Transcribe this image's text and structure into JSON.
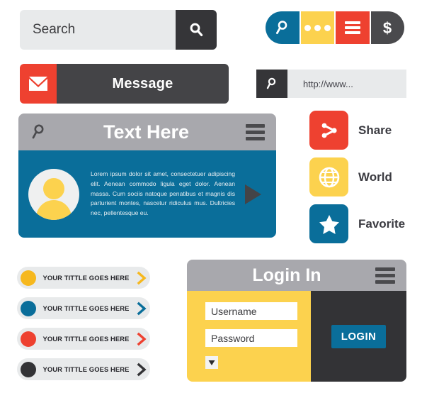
{
  "palette": {
    "blue": "#0a6e9a",
    "yellow": "#fcd24e",
    "amber": "#f6b81e",
    "red": "#ee4130",
    "dark": "#353538",
    "dark_alt": "#444447",
    "gray_header": "#a8a8ad",
    "light_gray": "#e8eaeb",
    "white": "#ffffff"
  },
  "search_bar": {
    "value": "Search",
    "placeholder": "Search",
    "button_icon": "search-icon"
  },
  "message_bar": {
    "label": "Message",
    "icon": "envelope-icon"
  },
  "pill_nav": {
    "segments": [
      {
        "icon": "search-icon",
        "color": "#0a6e9a"
      },
      {
        "icon": "dots-icon",
        "color": "#fcd24e"
      },
      {
        "icon": "hamburger-icon",
        "color": "#ee4130"
      },
      {
        "icon": "dollar-icon",
        "color": "#4a4a4d"
      }
    ]
  },
  "url_bar": {
    "icon": "search-icon",
    "value": "http://www...",
    "placeholder": "http://www..."
  },
  "widget_panel": {
    "header": {
      "search_icon": "search-icon",
      "title": "Text Here",
      "menu_icon": "hamburger-icon"
    },
    "avatar_icon": "user-avatar-icon",
    "body_text": "Lorem ipsum dolor sit amet, consectetuer adipiscing elit. Aenean commodo ligula eget dolor. Aenean massa. Cum sociis natoque penatibus et magnis dis parturient montes, nascetur ridiculus mus. Dultricies nec, pellentesque eu.",
    "next_icon": "play-icon"
  },
  "icon_list": [
    {
      "label": "Share",
      "icon": "share-icon",
      "color": "#ee4130"
    },
    {
      "label": "World",
      "icon": "globe-icon",
      "color": "#fcd24e"
    },
    {
      "label": "Favorite",
      "icon": "star-icon",
      "color": "#0a6e9a"
    }
  ],
  "title_pills": [
    {
      "label": "YOUR TITTLE GOES HERE",
      "color": "#f6b81e"
    },
    {
      "label": "YOUR TITTLE GOES HERE",
      "color": "#0a6e9a"
    },
    {
      "label": "YOUR TITTLE GOES HERE",
      "color": "#ee4130"
    },
    {
      "label": "YOUR TITTLE GOES HERE",
      "color": "#333336"
    }
  ],
  "login_panel": {
    "title": "Login In",
    "menu_icon": "hamburger-icon",
    "username": {
      "value": "Username",
      "placeholder": "Username"
    },
    "password": {
      "value": "Password",
      "placeholder": "Password"
    },
    "dropdown_icon": "chevron-down-icon",
    "submit_label": "LOGIN"
  }
}
